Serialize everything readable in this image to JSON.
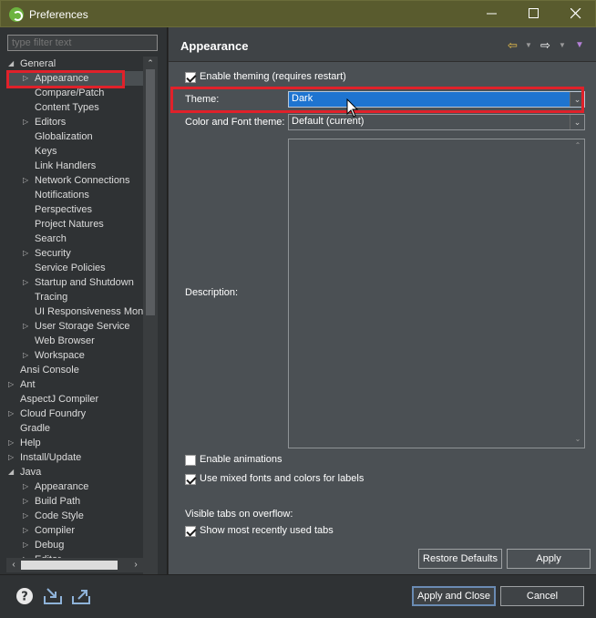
{
  "window": {
    "title": "Preferences"
  },
  "filter": {
    "placeholder": "type filter text"
  },
  "tree": [
    {
      "label": "General",
      "level": 0,
      "twisty": "expanded"
    },
    {
      "label": "Appearance",
      "level": 1,
      "twisty": "collapsed",
      "selected": true
    },
    {
      "label": "Compare/Patch",
      "level": 1,
      "twisty": "none"
    },
    {
      "label": "Content Types",
      "level": 1,
      "twisty": "none"
    },
    {
      "label": "Editors",
      "level": 1,
      "twisty": "collapsed"
    },
    {
      "label": "Globalization",
      "level": 1,
      "twisty": "none"
    },
    {
      "label": "Keys",
      "level": 1,
      "twisty": "none"
    },
    {
      "label": "Link Handlers",
      "level": 1,
      "twisty": "none"
    },
    {
      "label": "Network Connections",
      "level": 1,
      "twisty": "collapsed"
    },
    {
      "label": "Notifications",
      "level": 1,
      "twisty": "none"
    },
    {
      "label": "Perspectives",
      "level": 1,
      "twisty": "none"
    },
    {
      "label": "Project Natures",
      "level": 1,
      "twisty": "none"
    },
    {
      "label": "Search",
      "level": 1,
      "twisty": "none"
    },
    {
      "label": "Security",
      "level": 1,
      "twisty": "collapsed"
    },
    {
      "label": "Service Policies",
      "level": 1,
      "twisty": "none"
    },
    {
      "label": "Startup and Shutdown",
      "level": 1,
      "twisty": "collapsed"
    },
    {
      "label": "Tracing",
      "level": 1,
      "twisty": "none"
    },
    {
      "label": "UI Responsiveness Moni",
      "level": 1,
      "twisty": "none"
    },
    {
      "label": "User Storage Service",
      "level": 1,
      "twisty": "collapsed"
    },
    {
      "label": "Web Browser",
      "level": 1,
      "twisty": "none"
    },
    {
      "label": "Workspace",
      "level": 1,
      "twisty": "collapsed"
    },
    {
      "label": "Ansi Console",
      "level": 0,
      "twisty": "none"
    },
    {
      "label": "Ant",
      "level": 0,
      "twisty": "collapsed"
    },
    {
      "label": "AspectJ Compiler",
      "level": 0,
      "twisty": "none"
    },
    {
      "label": "Cloud Foundry",
      "level": 0,
      "twisty": "collapsed"
    },
    {
      "label": "Gradle",
      "level": 0,
      "twisty": "none"
    },
    {
      "label": "Help",
      "level": 0,
      "twisty": "collapsed"
    },
    {
      "label": "Install/Update",
      "level": 0,
      "twisty": "collapsed"
    },
    {
      "label": "Java",
      "level": 0,
      "twisty": "expanded"
    },
    {
      "label": "Appearance",
      "level": 1,
      "twisty": "collapsed"
    },
    {
      "label": "Build Path",
      "level": 1,
      "twisty": "collapsed"
    },
    {
      "label": "Code Style",
      "level": 1,
      "twisty": "collapsed"
    },
    {
      "label": "Compiler",
      "level": 1,
      "twisty": "collapsed"
    },
    {
      "label": "Debug",
      "level": 1,
      "twisty": "collapsed"
    },
    {
      "label": "Editor",
      "level": 1,
      "twisty": "collapsed"
    }
  ],
  "page": {
    "title": "Appearance",
    "enable_theming": {
      "label": "Enable theming (requires restart)",
      "checked": true
    },
    "theme": {
      "label": "Theme:",
      "value": "Dark"
    },
    "color_font_theme": {
      "label": "Color and Font theme:",
      "value": "Default (current)"
    },
    "description": {
      "label": "Description:"
    },
    "enable_animations": {
      "label": "Enable animations",
      "checked": false
    },
    "mixed_fonts": {
      "label": "Use mixed fonts and colors for labels",
      "checked": true
    },
    "visible_tabs_label": "Visible tabs on overflow:",
    "show_recent_tabs": {
      "label": "Show most recently used tabs",
      "checked": true
    },
    "restore_defaults": "Restore Defaults",
    "apply": "Apply"
  },
  "footer": {
    "apply_close": "Apply and Close",
    "cancel": "Cancel"
  },
  "icons": {
    "help": "help-icon",
    "import": "import-icon",
    "export": "export-icon"
  },
  "colors": {
    "title_bar": "#595b2e",
    "highlight_box": "#e0212a",
    "selection": "#1e74d0"
  }
}
